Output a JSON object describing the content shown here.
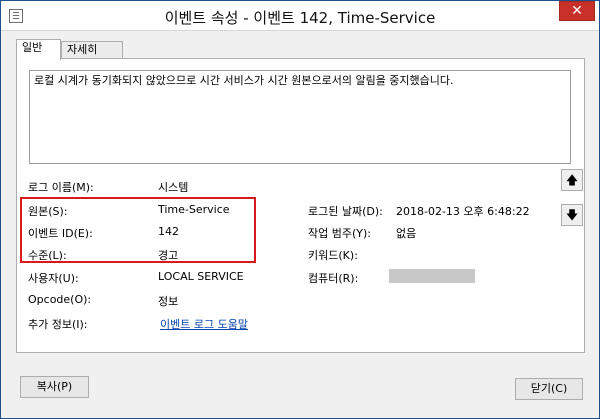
{
  "window": {
    "title": "이벤트 속성 - 이벤트 142, Time-Service",
    "close_glyph": "✕"
  },
  "tabs": [
    {
      "label": "일반",
      "active": true
    },
    {
      "label": "자세히",
      "active": false
    }
  ],
  "description": "로컬 시계가 동기화되지 않았으므로 시간 서비스가 시간 원본으로서의 알림을 중지했습니다.",
  "fields": {
    "log_name": {
      "label": "로그 이름(M):",
      "value": "시스템"
    },
    "source": {
      "label": "원본(S):",
      "value": "Time-Service"
    },
    "event_id": {
      "label": "이벤트 ID(E):",
      "value": "142"
    },
    "level": {
      "label": "수준(L):",
      "value": "경고"
    },
    "user": {
      "label": "사용자(U):",
      "value": "LOCAL SERVICE"
    },
    "opcode": {
      "label": "Opcode(O):",
      "value": "정보"
    },
    "more_info": {
      "label": "추가 정보(I):",
      "value": "이벤트 로그 도움말"
    },
    "logged": {
      "label": "로그된 날짜(D):",
      "value": "2018-02-13 오후 6:48:22"
    },
    "task_category": {
      "label": "작업 범주(Y):",
      "value": "없음"
    },
    "keywords": {
      "label": "키워드(K):",
      "value": ""
    },
    "computer": {
      "label": "컴퓨터(R):",
      "value": ""
    }
  },
  "nav": {
    "up_glyph": "🡅",
    "down_glyph": "🡇"
  },
  "buttons": {
    "copy": "복사(P)",
    "close": "닫기(C)"
  },
  "colors": {
    "highlight": "#d61a1a",
    "link": "#0645ad"
  }
}
